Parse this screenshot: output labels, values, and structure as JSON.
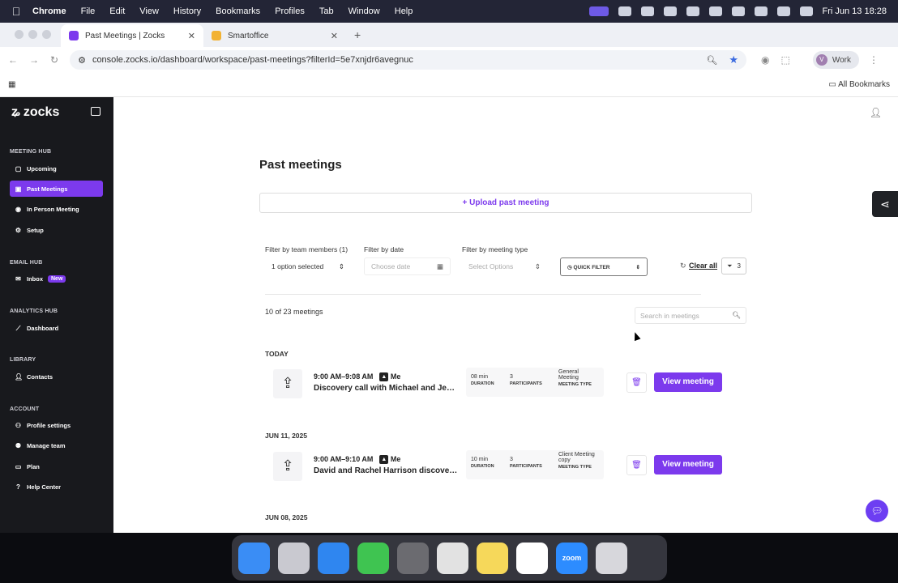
{
  "menubar": {
    "app": "Chrome",
    "items": [
      "File",
      "Edit",
      "View",
      "History",
      "Bookmarks",
      "Profiles",
      "Tab",
      "Window",
      "Help"
    ],
    "clock": "Fri Jun 13  18:28"
  },
  "browser": {
    "tabs": [
      {
        "title": "Past Meetings | Zocks"
      },
      {
        "title": "Smartoffice"
      }
    ],
    "url": "console.zocks.io/dashboard/workspace/past-meetings?filterId=5e7xnjdr6avegnuc",
    "profile_initial": "V",
    "profile": "Work",
    "bookmarks_label": "All Bookmarks"
  },
  "sidebar": {
    "logo": "zocks",
    "sections": [
      {
        "title": "MEETING HUB",
        "items": [
          {
            "label": "Upcoming",
            "icon": "calendar-icon"
          },
          {
            "label": "Past Meetings",
            "icon": "calendar-check-icon",
            "active": true
          },
          {
            "label": "In Person Meeting",
            "icon": "record-icon"
          },
          {
            "label": "Setup",
            "icon": "gear-icon"
          }
        ]
      },
      {
        "title": "EMAIL HUB",
        "items": [
          {
            "label": "Inbox",
            "icon": "inbox-icon",
            "badge": "New"
          }
        ]
      },
      {
        "title": "ANALYTICS HUB",
        "items": [
          {
            "label": "Dashboard",
            "icon": "chart-icon"
          }
        ]
      },
      {
        "title": "LIBRARY",
        "items": [
          {
            "label": "Contacts",
            "icon": "contacts-icon"
          }
        ]
      },
      {
        "title": "ACCOUNT",
        "items": [
          {
            "label": "Profile settings",
            "icon": "user-icon"
          },
          {
            "label": "Manage team",
            "icon": "team-icon"
          },
          {
            "label": "Plan",
            "icon": "card-icon"
          },
          {
            "label": "Help Center",
            "icon": "help-icon"
          }
        ]
      }
    ]
  },
  "main": {
    "title": "Past meetings",
    "upload_label": "+ Upload past meeting",
    "filters": {
      "team_label": "Filter by team members (1)",
      "team_value": "1 option selected",
      "date_label": "Filter by date",
      "date_placeholder": "Choose date",
      "type_label": "Filter by meeting type",
      "type_placeholder": "Select Options",
      "quick_filter": "QUICK FILTER",
      "clear_all": "Clear all",
      "filter_count": "3"
    },
    "count_text": "10 of 23 meetings",
    "search_placeholder": "Search in meetings",
    "groups": [
      {
        "date": "TODAY",
        "meetings": [
          {
            "time": "9:00 AM–9:08 AM",
            "owner": "Me",
            "title": "Discovery call with Michael and Jennifer",
            "duration": "08 min",
            "participants": "3",
            "type_line1": "General",
            "type_line2": "Meeting",
            "duration_label": "DURATION",
            "participants_label": "PARTICIPANTS",
            "type_label": "MEETING TYPE",
            "action": "View meeting"
          }
        ]
      },
      {
        "date": "JUN 11, 2025",
        "meetings": [
          {
            "time": "9:00 AM–9:10 AM",
            "owner": "Me",
            "title": "David and Rachel Harrison discovery call",
            "duration": "10 min",
            "participants": "3",
            "type_line1": "Client Meeting",
            "type_line2": "copy",
            "duration_label": "DURATION",
            "participants_label": "PARTICIPANTS",
            "type_label": "MEETING TYPE",
            "action": "View meeting"
          }
        ]
      },
      {
        "date": "JUN 08, 2025",
        "meetings": []
      }
    ]
  },
  "dock": {
    "apps": [
      {
        "label": "",
        "color": "#3a8df5"
      },
      {
        "label": "",
        "color": "#c9c9d0"
      },
      {
        "label": "",
        "color": "#2f86f0"
      },
      {
        "label": "",
        "color": "#3fc451"
      },
      {
        "label": "",
        "color": "#6b6b70"
      },
      {
        "label": "",
        "color": "#e2e2e2"
      },
      {
        "label": "",
        "color": "#f6d85a"
      },
      {
        "label": "",
        "color": "#ffffff"
      },
      {
        "label": "zoom",
        "color": "#2d8cff"
      },
      {
        "label": "",
        "color": "#d7d7dc"
      }
    ]
  }
}
